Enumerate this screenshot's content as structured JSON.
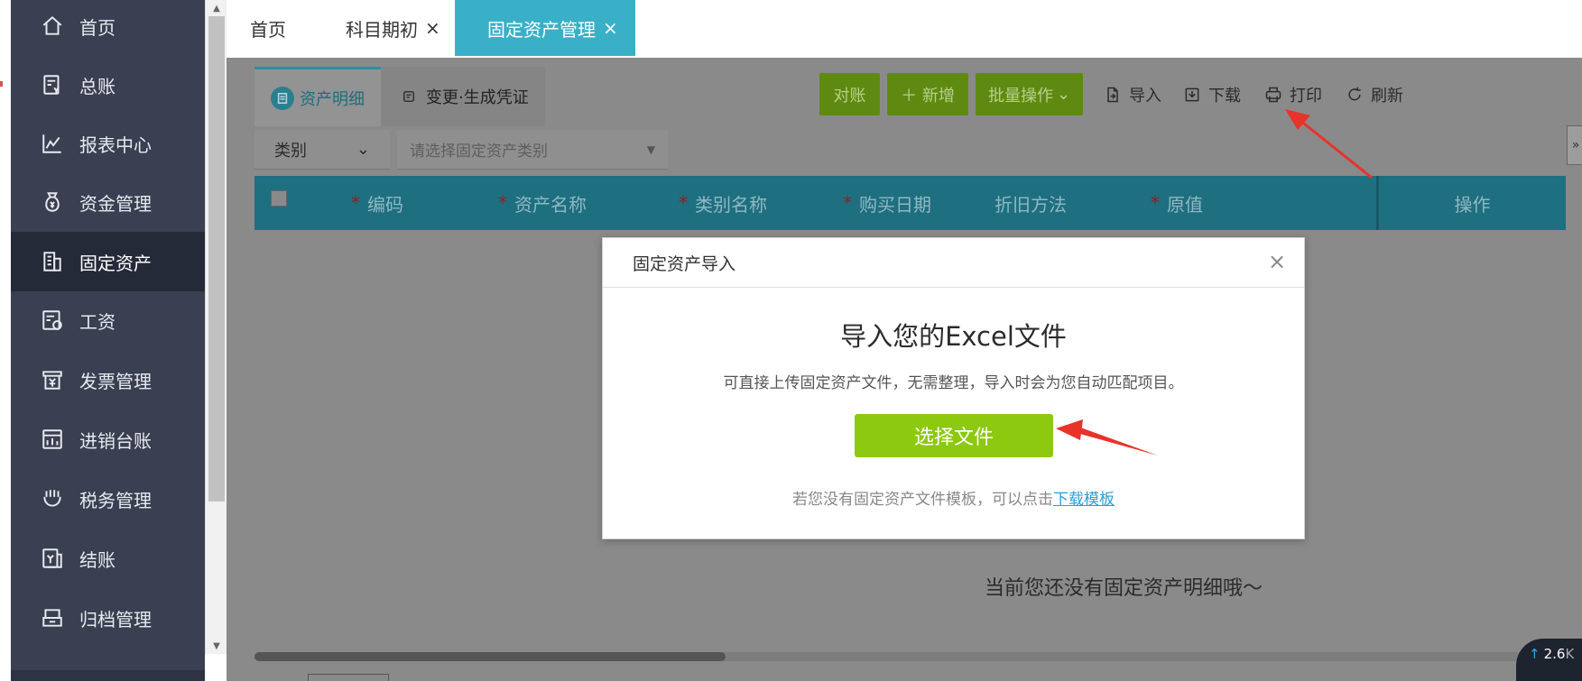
{
  "sidebar": {
    "items": [
      {
        "label": "首页",
        "icon": "home-icon"
      },
      {
        "label": "总账",
        "icon": "ledger-icon"
      },
      {
        "label": "报表中心",
        "icon": "chart-icon"
      },
      {
        "label": "资金管理",
        "icon": "money-bag-icon"
      },
      {
        "label": "固定资产",
        "icon": "building-icon",
        "active": true
      },
      {
        "label": "工资",
        "icon": "salary-icon"
      },
      {
        "label": "发票管理",
        "icon": "invoice-icon"
      },
      {
        "label": "进销台账",
        "icon": "inventory-icon"
      },
      {
        "label": "税务管理",
        "icon": "tax-icon"
      },
      {
        "label": "结账",
        "icon": "closing-icon"
      },
      {
        "label": "归档管理",
        "icon": "archive-icon"
      }
    ]
  },
  "tabs": [
    {
      "label": "首页",
      "closable": false
    },
    {
      "label": "科目期初",
      "closable": true
    },
    {
      "label": "固定资产管理",
      "closable": true,
      "active": true
    }
  ],
  "close_glyph": "×",
  "subtabs": {
    "detail": "资产明细",
    "change": "变更·生成凭证"
  },
  "toolbar": {
    "reconcile": "对账",
    "add": "＋ 新增",
    "batch": "批量操作",
    "import": "导入",
    "download": "下载",
    "print": "打印",
    "refresh": "刷新"
  },
  "filter": {
    "type_label": "类别",
    "category_placeholder": "请选择固定资产类别"
  },
  "table": {
    "columns": [
      {
        "label": "编码",
        "required": true
      },
      {
        "label": "资产名称",
        "required": true
      },
      {
        "label": "类别名称",
        "required": true
      },
      {
        "label": "购买日期",
        "required": true
      },
      {
        "label": "折旧方法",
        "required": false
      },
      {
        "label": "原值",
        "required": true
      }
    ],
    "ops_label": "操作",
    "required_mark": "*",
    "empty_text": "当前您还没有固定资产明细哦～"
  },
  "modal": {
    "header": "固定资产导入",
    "title": "导入您的Excel文件",
    "desc": "可直接上传固定资产文件，无需整理，导入时会为您自动匹配项目。",
    "choose_button": "选择文件",
    "foot_text": "若您没有固定资产文件模板，可以点击",
    "foot_link": "下载模板"
  },
  "collapse_glyph": "»",
  "speed": {
    "value": "2.6",
    "unit": "K"
  },
  "colors": {
    "sidebar_bg": "#3a3f51",
    "accent": "#3ab0c8",
    "green": "#8cc90f",
    "annotation": "#e8322a"
  }
}
